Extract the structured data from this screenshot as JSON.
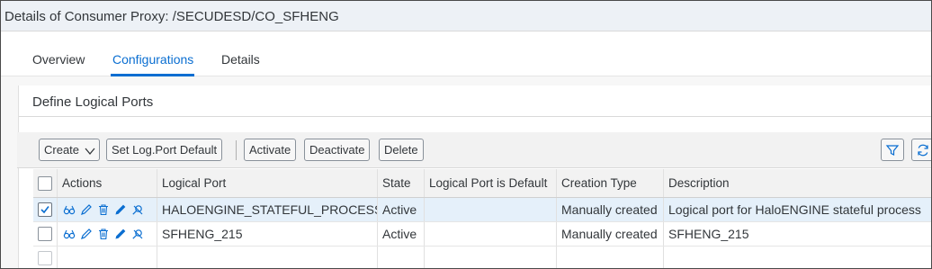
{
  "window": {
    "title": "Details of Consumer Proxy: /SECUDESD/CO_SFHENG"
  },
  "tabs": [
    {
      "label": "Overview",
      "active": false
    },
    {
      "label": "Configurations",
      "active": true
    },
    {
      "label": "Details",
      "active": false
    }
  ],
  "section": {
    "title": "Define Logical Ports"
  },
  "toolbar": {
    "create_label": "Create",
    "set_default_label": "Set Log.Port Default",
    "activate_label": "Activate",
    "deactivate_label": "Deactivate",
    "delete_label": "Delete",
    "icons": [
      "filter-icon",
      "refresh-icon"
    ]
  },
  "table": {
    "columns": [
      "Actions",
      "Logical Port",
      "State",
      "Logical Port is Default",
      "Creation Type",
      "Description"
    ],
    "row_action_icons": [
      "display-icon",
      "edit-icon",
      "delete-icon",
      "edit-alt-icon",
      "ping-icon"
    ],
    "rows": [
      {
        "selected": true,
        "logical_port": "HALOENGINE_STATEFUL_PROCESS",
        "state": "Active",
        "is_default": "",
        "creation_type": "Manually created",
        "description": "Logical port for HaloENGINE stateful process"
      },
      {
        "selected": false,
        "logical_port": "SFHENG_215",
        "state": "Active",
        "is_default": "",
        "creation_type": "Manually created",
        "description": "SFHENG_215"
      }
    ]
  },
  "colors": {
    "accent": "#0a6ed1",
    "selected_row": "#e5f0fa",
    "icon": "#0a6ed1"
  }
}
